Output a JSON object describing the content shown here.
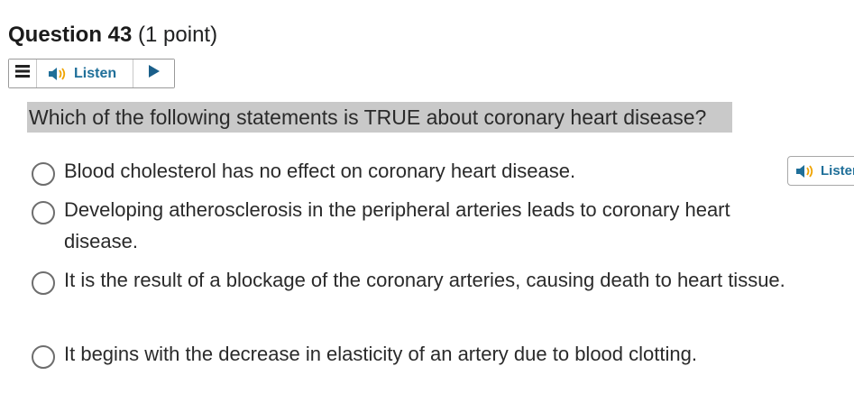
{
  "question": {
    "title": "Question 43",
    "points": "(1 point)",
    "text": "Which of the following statements is TRUE about coronary heart disease?"
  },
  "listen_bar": {
    "label": "Listen",
    "icons": [
      "menu-icon",
      "speaker-icon",
      "play-icon"
    ],
    "accent_color": "#1f6f99",
    "play_color": "#1a5f8a"
  },
  "choices": [
    {
      "text": "Blood cholesterol has no effect on coronary heart disease."
    },
    {
      "text": "Developing atherosclerosis in the peripheral arteries leads to coronary heart disease."
    },
    {
      "text": "It is the result of a blockage of the coronary arteries, causing death to heart tissue."
    },
    {
      "text": "It begins with the decrease in elasticity of an artery due to blood clotting."
    }
  ],
  "floating_listen": {
    "label": "Listen"
  }
}
